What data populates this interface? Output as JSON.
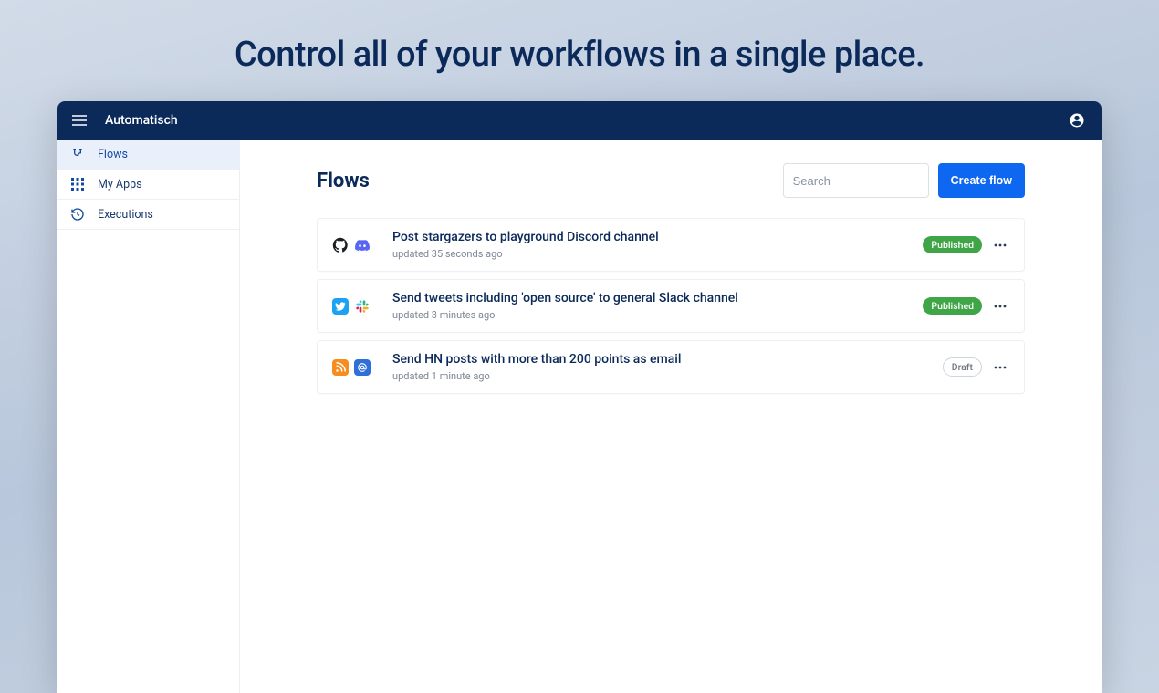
{
  "hero": {
    "title": "Control all of your workflows in a single place."
  },
  "header": {
    "brand": "Automatisch"
  },
  "sidebar": {
    "items": [
      {
        "label": "Flows",
        "icon": "flows-icon",
        "active": true
      },
      {
        "label": "My Apps",
        "icon": "apps-icon",
        "active": false
      },
      {
        "label": "Executions",
        "icon": "history-icon",
        "active": false
      }
    ]
  },
  "page": {
    "title": "Flows",
    "search_placeholder": "Search",
    "create_label": "Create flow"
  },
  "status_labels": {
    "published": "Published",
    "draft": "Draft"
  },
  "flows": [
    {
      "title": "Post stargazers to playground Discord channel",
      "updated": "updated 35 seconds ago",
      "status": "published",
      "apps": [
        "github",
        "discord"
      ]
    },
    {
      "title": "Send tweets including 'open source' to general Slack channel",
      "updated": "updated 3 minutes ago",
      "status": "published",
      "apps": [
        "twitter",
        "slack"
      ]
    },
    {
      "title": "Send HN posts with more than 200 points as email",
      "updated": "updated 1 minute ago",
      "status": "draft",
      "apps": [
        "rss",
        "email"
      ]
    }
  ]
}
